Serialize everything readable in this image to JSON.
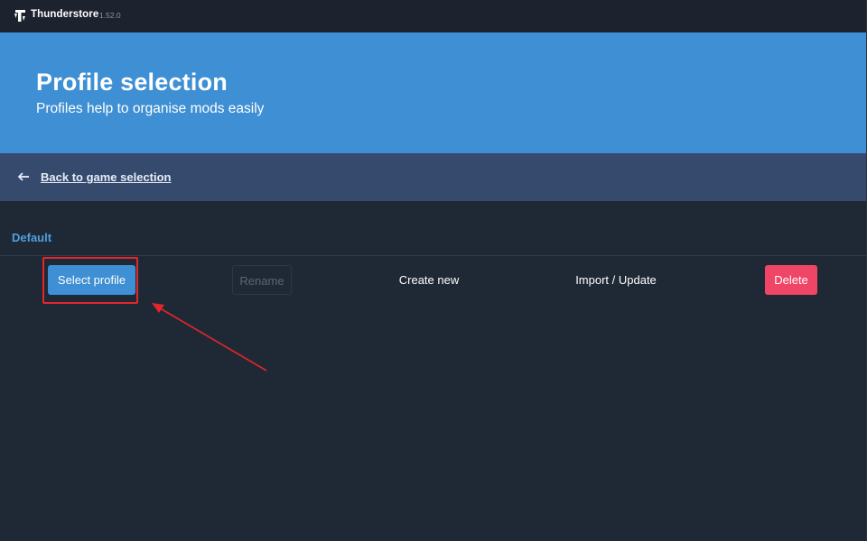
{
  "titlebar": {
    "app_name": "Thunderstore",
    "version": "1.52.0",
    "logo_icon": "thunderstore-logo-icon"
  },
  "hero": {
    "title": "Profile selection",
    "subtitle": "Profiles help to organise mods easily"
  },
  "backbar": {
    "icon": "left-arrow-icon",
    "link_label": "Back to game selection"
  },
  "profile": {
    "name": "Default",
    "actions": {
      "select_label": "Select profile",
      "rename_label": "Rename",
      "create_label": "Create new",
      "import_label": "Import / Update",
      "delete_label": "Delete"
    }
  },
  "colors": {
    "accent": "#3e8fd3",
    "background": "#1f2935",
    "titlebar": "#1c232e",
    "backbar": "#364a6e",
    "profile_name": "#4f9fe0",
    "danger": "#ef4566",
    "annotation": "#e3262b"
  }
}
